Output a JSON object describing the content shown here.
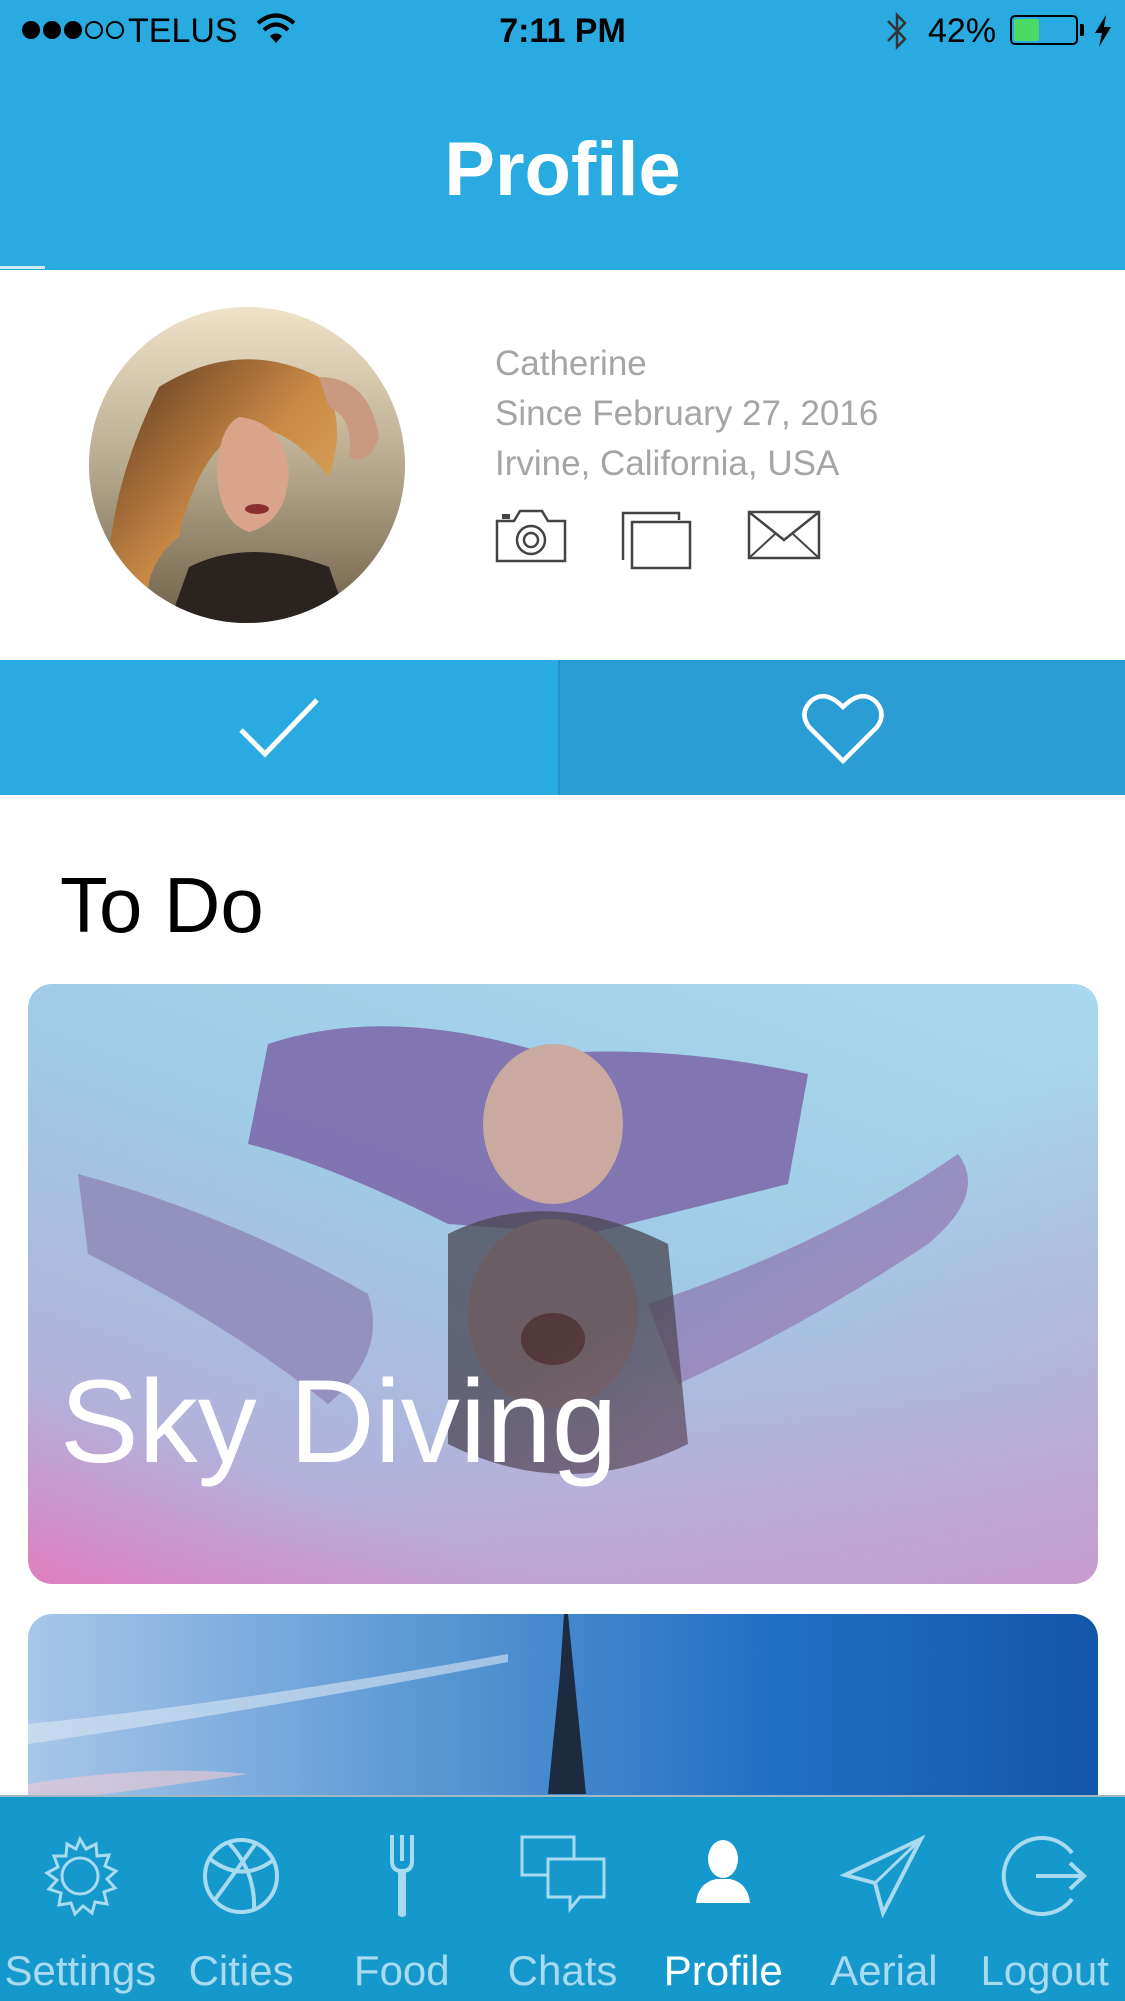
{
  "status_bar": {
    "carrier": "TELUS",
    "time": "7:11 PM",
    "battery_percent": "42%",
    "battery_level": 0.42,
    "signal_bars_filled": 3,
    "signal_bars_total": 5
  },
  "header": {
    "title": "Profile"
  },
  "profile": {
    "name": "Catherine",
    "since": "Since February 27, 2016",
    "location": "Irvine, California, USA",
    "actions": [
      "camera-icon",
      "gallery-icon",
      "mail-icon"
    ]
  },
  "action_bar": {
    "left_icon": "check-icon",
    "right_icon": "heart-icon"
  },
  "section": {
    "title": "To Do"
  },
  "cards": [
    {
      "label": "Sky Diving"
    },
    {
      "label": ""
    }
  ],
  "tab_bar": {
    "items": [
      {
        "label": "Settings",
        "icon": "gear-icon"
      },
      {
        "label": "Cities",
        "icon": "basketball-icon"
      },
      {
        "label": "Food",
        "icon": "fork-icon"
      },
      {
        "label": "Chats",
        "icon": "chat-bubbles-icon"
      },
      {
        "label": "Profile",
        "icon": "person-icon"
      },
      {
        "label": "Aerial",
        "icon": "paper-plane-icon"
      },
      {
        "label": "Logout",
        "icon": "logout-icon"
      }
    ],
    "active": "Profile"
  },
  "colors": {
    "brand": "#29aae1",
    "tab_bar": "#1598cb",
    "info_text": "#a5a5a5"
  }
}
